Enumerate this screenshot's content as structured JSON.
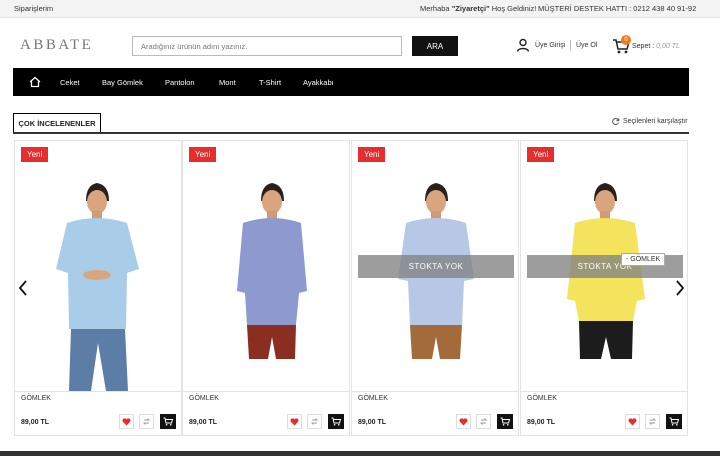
{
  "topbar": {
    "orders": "Siparişlerim",
    "greeting_prefix": "Merhaba ",
    "greeting_name": "\"Ziyaretçi\"",
    "greeting_suffix": " Hoş Geldiniz!",
    "support": "MÜŞTERİ DESTEK HATTI : 0212 438 40 91-92"
  },
  "header": {
    "logo": "ABBATE",
    "search_placeholder": "Aradığınız ürünün adını yazınız.",
    "search_button": "ARA",
    "login": "Üye Girişi",
    "register": "Üye Ol",
    "cart_count": "0",
    "cart_label": "Sepet : ",
    "cart_amount": "0,00 TL"
  },
  "nav": {
    "items": [
      "Ceket",
      "Bay Gömlek",
      "Pantolon",
      "Mont",
      "T-Shirt",
      "Ayakkabı"
    ]
  },
  "section": {
    "title": "ÇOK İNCELENENLER",
    "compare": "Seçilenleri karşılaştır"
  },
  "products": [
    {
      "badge": "Yeni",
      "name": "GÖMLEK",
      "price": "89,00 TL",
      "shirt_color": "#a9cde9",
      "pants_color": "#5c7ea6",
      "stock_note": ""
    },
    {
      "badge": "Yeni",
      "name": "GÖMLEK",
      "price": "89,00 TL",
      "shirt_color": "#8e99cf",
      "pants_color": "#8a2e22",
      "stock_note": ""
    },
    {
      "badge": "Yeni",
      "name": "GÖMLEK",
      "price": "89,00 TL",
      "shirt_color": "#b7c8e6",
      "pants_color": "#a36a3b",
      "stock_note": "STOKTA YOK"
    },
    {
      "badge": "Yeni",
      "name": "GÖMLEK",
      "price": "89,00 TL",
      "shirt_color": "#f4e35c",
      "pants_color": "#1c1c1c",
      "stock_note": "STOKTA YOK"
    }
  ],
  "tooltip": "- GÖMLEK",
  "colors": {
    "accent_red": "#e62e2e",
    "nav_bg": "#000000",
    "cart_badge": "#f07b1f"
  }
}
